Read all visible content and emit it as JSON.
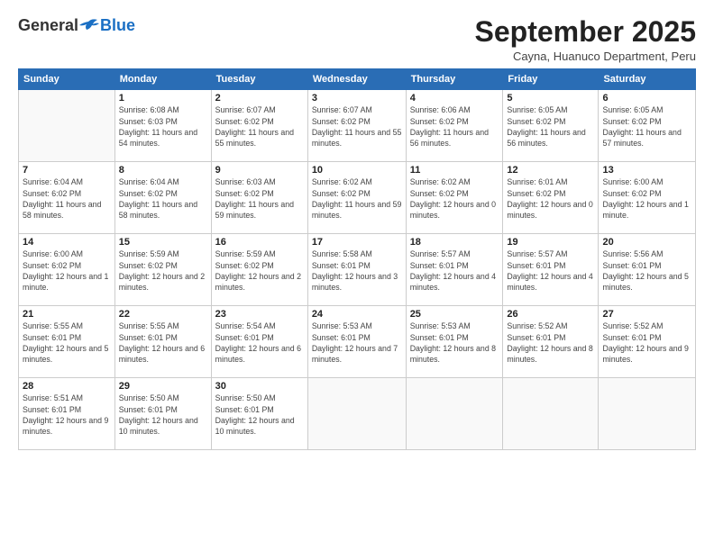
{
  "header": {
    "logo_general": "General",
    "logo_blue": "Blue",
    "month_title": "September 2025",
    "location": "Cayna, Huanuco Department, Peru"
  },
  "days_of_week": [
    "Sunday",
    "Monday",
    "Tuesday",
    "Wednesday",
    "Thursday",
    "Friday",
    "Saturday"
  ],
  "weeks": [
    [
      {
        "day": "",
        "sunrise": "",
        "sunset": "",
        "daylight": ""
      },
      {
        "day": "1",
        "sunrise": "Sunrise: 6:08 AM",
        "sunset": "Sunset: 6:03 PM",
        "daylight": "Daylight: 11 hours and 54 minutes."
      },
      {
        "day": "2",
        "sunrise": "Sunrise: 6:07 AM",
        "sunset": "Sunset: 6:02 PM",
        "daylight": "Daylight: 11 hours and 55 minutes."
      },
      {
        "day": "3",
        "sunrise": "Sunrise: 6:07 AM",
        "sunset": "Sunset: 6:02 PM",
        "daylight": "Daylight: 11 hours and 55 minutes."
      },
      {
        "day": "4",
        "sunrise": "Sunrise: 6:06 AM",
        "sunset": "Sunset: 6:02 PM",
        "daylight": "Daylight: 11 hours and 56 minutes."
      },
      {
        "day": "5",
        "sunrise": "Sunrise: 6:05 AM",
        "sunset": "Sunset: 6:02 PM",
        "daylight": "Daylight: 11 hours and 56 minutes."
      },
      {
        "day": "6",
        "sunrise": "Sunrise: 6:05 AM",
        "sunset": "Sunset: 6:02 PM",
        "daylight": "Daylight: 11 hours and 57 minutes."
      }
    ],
    [
      {
        "day": "7",
        "sunrise": "Sunrise: 6:04 AM",
        "sunset": "Sunset: 6:02 PM",
        "daylight": "Daylight: 11 hours and 58 minutes."
      },
      {
        "day": "8",
        "sunrise": "Sunrise: 6:04 AM",
        "sunset": "Sunset: 6:02 PM",
        "daylight": "Daylight: 11 hours and 58 minutes."
      },
      {
        "day": "9",
        "sunrise": "Sunrise: 6:03 AM",
        "sunset": "Sunset: 6:02 PM",
        "daylight": "Daylight: 11 hours and 59 minutes."
      },
      {
        "day": "10",
        "sunrise": "Sunrise: 6:02 AM",
        "sunset": "Sunset: 6:02 PM",
        "daylight": "Daylight: 11 hours and 59 minutes."
      },
      {
        "day": "11",
        "sunrise": "Sunrise: 6:02 AM",
        "sunset": "Sunset: 6:02 PM",
        "daylight": "Daylight: 12 hours and 0 minutes."
      },
      {
        "day": "12",
        "sunrise": "Sunrise: 6:01 AM",
        "sunset": "Sunset: 6:02 PM",
        "daylight": "Daylight: 12 hours and 0 minutes."
      },
      {
        "day": "13",
        "sunrise": "Sunrise: 6:00 AM",
        "sunset": "Sunset: 6:02 PM",
        "daylight": "Daylight: 12 hours and 1 minute."
      }
    ],
    [
      {
        "day": "14",
        "sunrise": "Sunrise: 6:00 AM",
        "sunset": "Sunset: 6:02 PM",
        "daylight": "Daylight: 12 hours and 1 minute."
      },
      {
        "day": "15",
        "sunrise": "Sunrise: 5:59 AM",
        "sunset": "Sunset: 6:02 PM",
        "daylight": "Daylight: 12 hours and 2 minutes."
      },
      {
        "day": "16",
        "sunrise": "Sunrise: 5:59 AM",
        "sunset": "Sunset: 6:02 PM",
        "daylight": "Daylight: 12 hours and 2 minutes."
      },
      {
        "day": "17",
        "sunrise": "Sunrise: 5:58 AM",
        "sunset": "Sunset: 6:01 PM",
        "daylight": "Daylight: 12 hours and 3 minutes."
      },
      {
        "day": "18",
        "sunrise": "Sunrise: 5:57 AM",
        "sunset": "Sunset: 6:01 PM",
        "daylight": "Daylight: 12 hours and 4 minutes."
      },
      {
        "day": "19",
        "sunrise": "Sunrise: 5:57 AM",
        "sunset": "Sunset: 6:01 PM",
        "daylight": "Daylight: 12 hours and 4 minutes."
      },
      {
        "day": "20",
        "sunrise": "Sunrise: 5:56 AM",
        "sunset": "Sunset: 6:01 PM",
        "daylight": "Daylight: 12 hours and 5 minutes."
      }
    ],
    [
      {
        "day": "21",
        "sunrise": "Sunrise: 5:55 AM",
        "sunset": "Sunset: 6:01 PM",
        "daylight": "Daylight: 12 hours and 5 minutes."
      },
      {
        "day": "22",
        "sunrise": "Sunrise: 5:55 AM",
        "sunset": "Sunset: 6:01 PM",
        "daylight": "Daylight: 12 hours and 6 minutes."
      },
      {
        "day": "23",
        "sunrise": "Sunrise: 5:54 AM",
        "sunset": "Sunset: 6:01 PM",
        "daylight": "Daylight: 12 hours and 6 minutes."
      },
      {
        "day": "24",
        "sunrise": "Sunrise: 5:53 AM",
        "sunset": "Sunset: 6:01 PM",
        "daylight": "Daylight: 12 hours and 7 minutes."
      },
      {
        "day": "25",
        "sunrise": "Sunrise: 5:53 AM",
        "sunset": "Sunset: 6:01 PM",
        "daylight": "Daylight: 12 hours and 8 minutes."
      },
      {
        "day": "26",
        "sunrise": "Sunrise: 5:52 AM",
        "sunset": "Sunset: 6:01 PM",
        "daylight": "Daylight: 12 hours and 8 minutes."
      },
      {
        "day": "27",
        "sunrise": "Sunrise: 5:52 AM",
        "sunset": "Sunset: 6:01 PM",
        "daylight": "Daylight: 12 hours and 9 minutes."
      }
    ],
    [
      {
        "day": "28",
        "sunrise": "Sunrise: 5:51 AM",
        "sunset": "Sunset: 6:01 PM",
        "daylight": "Daylight: 12 hours and 9 minutes."
      },
      {
        "day": "29",
        "sunrise": "Sunrise: 5:50 AM",
        "sunset": "Sunset: 6:01 PM",
        "daylight": "Daylight: 12 hours and 10 minutes."
      },
      {
        "day": "30",
        "sunrise": "Sunrise: 5:50 AM",
        "sunset": "Sunset: 6:01 PM",
        "daylight": "Daylight: 12 hours and 10 minutes."
      },
      {
        "day": "",
        "sunrise": "",
        "sunset": "",
        "daylight": ""
      },
      {
        "day": "",
        "sunrise": "",
        "sunset": "",
        "daylight": ""
      },
      {
        "day": "",
        "sunrise": "",
        "sunset": "",
        "daylight": ""
      },
      {
        "day": "",
        "sunrise": "",
        "sunset": "",
        "daylight": ""
      }
    ]
  ]
}
